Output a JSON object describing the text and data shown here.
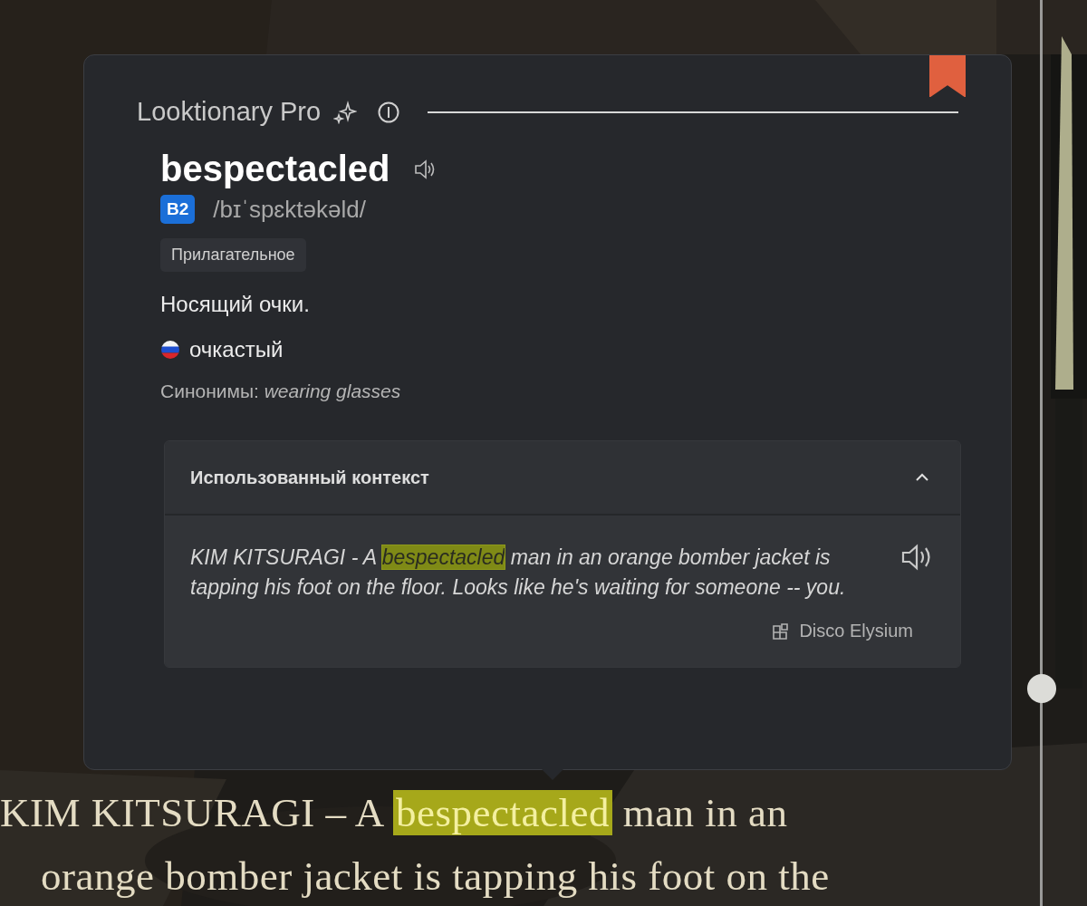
{
  "popup": {
    "app_title": "Looktionary Pro",
    "bookmarked": true,
    "word": "bespectacled",
    "level_badge": "B2",
    "transcription": "/bɪˈspɛktəkəld/",
    "part_of_speech": "Прилагательное",
    "definition": "Носящий очки.",
    "translation": "очкастый",
    "synonyms": "Синонимы: *wearing glasses*",
    "context": {
      "title": "Использованный контекст",
      "expanded": true,
      "quote": [
        {
          "text": "KIM KITSURAGI - A ",
          "highlighted": false
        },
        {
          "text": "bespectacled",
          "highlighted": true
        },
        {
          "text": " man in an orange bomber jacket is tapping his foot on the floor. Looks like he's waiting for someone -- you.",
          "highlighted": false
        }
      ],
      "source": "Disco Elysium"
    }
  },
  "subtitles": [
    [
      {
        "text": "KIM KITSURAGI – A ",
        "highlighted": false
      },
      {
        "text": "bespectacled",
        "highlighted": true
      },
      {
        "text": " man in an",
        "highlighted": false
      }
    ],
    [
      {
        "text": "orange bomber jacket is tapping his foot on the",
        "highlighted": false
      }
    ]
  ],
  "background": {
    "kind": "picture"
  }
}
